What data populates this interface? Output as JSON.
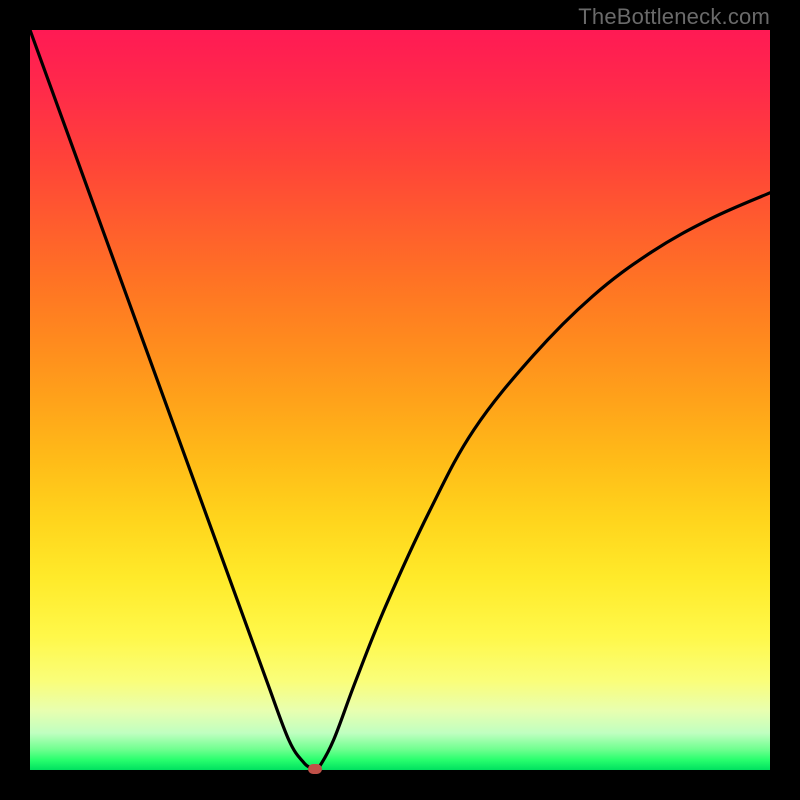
{
  "watermark": "TheBottleneck.com",
  "colors": {
    "background": "#000000",
    "curve": "#000000",
    "marker": "#c05048",
    "gradient_top": "#ff1a54",
    "gradient_bottom": "#00e060"
  },
  "chart_data": {
    "type": "line",
    "title": "",
    "xlabel": "",
    "ylabel": "",
    "xlim": [
      0,
      100
    ],
    "ylim": [
      0,
      100
    ],
    "grid": false,
    "legend": false,
    "notes": "V-shaped bottleneck curve over rainbow gradient; y is bottleneck percentage (red=high, green=low). Minimum near x≈38 touches y≈0. Axes are unlabeled in the source image; values estimated from pixel positions.",
    "series": [
      {
        "name": "bottleneck-curve",
        "x": [
          0,
          4,
          8,
          12,
          16,
          20,
          24,
          28,
          32,
          35,
          37,
          38,
          38.5,
          39,
          41,
          44,
          48,
          54,
          60,
          68,
          76,
          84,
          92,
          100
        ],
        "y": [
          100,
          89,
          78,
          67,
          56,
          45,
          34,
          23,
          12,
          4,
          1,
          0.3,
          0.2,
          0.3,
          4,
          12,
          22,
          35,
          46,
          56,
          64,
          70,
          74.5,
          78
        ]
      }
    ],
    "marker": {
      "x": 38.5,
      "y": 0.2
    }
  }
}
